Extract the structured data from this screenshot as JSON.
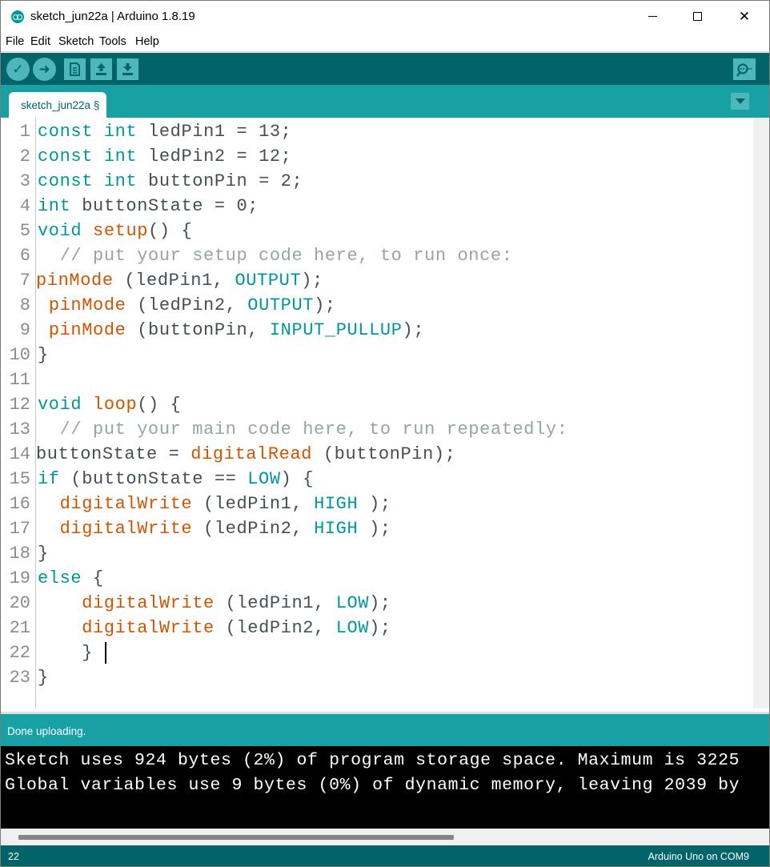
{
  "window": {
    "title": "sketch_jun22a | Arduino 1.8.19",
    "minimize_glyph": "",
    "close_glyph": "✕"
  },
  "menu": [
    "File",
    "Edit",
    "Sketch",
    "Tools",
    "Help"
  ],
  "toolbar": {
    "buttons": [
      "verify-icon",
      "upload-icon",
      "new-icon",
      "open-icon",
      "save-icon",
      "serial-monitor-icon"
    ],
    "verify_glyph": "✓",
    "upload_glyph": "➜"
  },
  "tab": {
    "label": "sketch_jun22a §"
  },
  "editor": {
    "lines": [
      {
        "num": "1",
        "tokens": [
          [
            "kw",
            "const"
          ],
          [
            "t",
            " "
          ],
          [
            "kw",
            "int"
          ],
          [
            "t",
            " ledPin1 = 13;"
          ]
        ]
      },
      {
        "num": "2",
        "tokens": [
          [
            "kw",
            "const"
          ],
          [
            "t",
            " "
          ],
          [
            "kw",
            "int"
          ],
          [
            "t",
            " ledPin2 = 12;"
          ]
        ]
      },
      {
        "num": "3",
        "tokens": [
          [
            "kw",
            "const"
          ],
          [
            "t",
            " "
          ],
          [
            "kw",
            "int"
          ],
          [
            "t",
            " buttonPin = 2;"
          ]
        ]
      },
      {
        "num": "4",
        "tokens": [
          [
            "kw",
            "int"
          ],
          [
            "t",
            " buttonState = 0;"
          ]
        ]
      },
      {
        "num": "5",
        "tokens": [
          [
            "kw",
            "void"
          ],
          [
            "t",
            " "
          ],
          [
            "fn",
            "setup"
          ],
          [
            "t",
            "() {"
          ]
        ]
      },
      {
        "num": "6",
        "tokens": [
          [
            "cm",
            "  // put your setup code here, to run once:"
          ]
        ]
      },
      {
        "num": "7",
        "tokens": [
          [
            "fn",
            "pinMode"
          ],
          [
            "t",
            " (ledPin1, "
          ],
          [
            "cst",
            "OUTPUT"
          ],
          [
            "t",
            ");"
          ]
        ]
      },
      {
        "num": "8",
        "tokens": [
          [
            "t",
            " "
          ],
          [
            "fn",
            "pinMode"
          ],
          [
            "t",
            " (ledPin2, "
          ],
          [
            "cst",
            "OUTPUT"
          ],
          [
            "t",
            ");"
          ]
        ]
      },
      {
        "num": "9",
        "tokens": [
          [
            "t",
            " "
          ],
          [
            "fn",
            "pinMode"
          ],
          [
            "t",
            " (buttonPin, "
          ],
          [
            "cst",
            "INPUT_PULLUP"
          ],
          [
            "t",
            ");"
          ]
        ]
      },
      {
        "num": "10",
        "tokens": [
          [
            "t",
            "}"
          ]
        ]
      },
      {
        "num": "11",
        "tokens": []
      },
      {
        "num": "12",
        "tokens": [
          [
            "kw",
            "void"
          ],
          [
            "t",
            " "
          ],
          [
            "fn",
            "loop"
          ],
          [
            "t",
            "() {"
          ]
        ]
      },
      {
        "num": "13",
        "tokens": [
          [
            "cm",
            "  // put your main code here, to run repeatedly:"
          ]
        ]
      },
      {
        "num": "14",
        "tokens": [
          [
            "t",
            "buttonState = "
          ],
          [
            "fn",
            "digitalRead"
          ],
          [
            "t",
            " (buttonPin);"
          ]
        ]
      },
      {
        "num": "15",
        "tokens": [
          [
            "kw",
            "if"
          ],
          [
            "t",
            " (buttonState == "
          ],
          [
            "cst",
            "LOW"
          ],
          [
            "t",
            ") {"
          ]
        ]
      },
      {
        "num": "16",
        "tokens": [
          [
            "t",
            "  "
          ],
          [
            "fn",
            "digitalWrite"
          ],
          [
            "t",
            " (ledPin1, "
          ],
          [
            "cst",
            "HIGH"
          ],
          [
            "t",
            " );"
          ]
        ]
      },
      {
        "num": "17",
        "tokens": [
          [
            "t",
            "  "
          ],
          [
            "fn",
            "digitalWrite"
          ],
          [
            "t",
            " (ledPin2, "
          ],
          [
            "cst",
            "HIGH"
          ],
          [
            "t",
            " );"
          ]
        ]
      },
      {
        "num": "18",
        "tokens": [
          [
            "t",
            "}"
          ]
        ]
      },
      {
        "num": "19",
        "tokens": [
          [
            "kw",
            "else"
          ],
          [
            "t",
            " {"
          ]
        ]
      },
      {
        "num": "20",
        "tokens": [
          [
            "t",
            "    "
          ],
          [
            "fn",
            "digitalWrite"
          ],
          [
            "t",
            " (ledPin1, "
          ],
          [
            "cst",
            "LOW"
          ],
          [
            "t",
            ");"
          ]
        ]
      },
      {
        "num": "21",
        "tokens": [
          [
            "t",
            "    "
          ],
          [
            "fn",
            "digitalWrite"
          ],
          [
            "t",
            " (ledPin2, "
          ],
          [
            "cst",
            "LOW"
          ],
          [
            "t",
            ");"
          ]
        ]
      },
      {
        "num": "22",
        "tokens": [
          [
            "t",
            "    } "
          ]
        ]
      },
      {
        "num": "23",
        "tokens": [
          [
            "t",
            "}"
          ]
        ]
      }
    ]
  },
  "status": {
    "message": "Done uploading."
  },
  "console": {
    "lines": [
      "Sketch uses 924 bytes (2%) of program storage space. Maximum is 3225",
      "Global variables use 9 bytes (0%) of dynamic memory, leaving 2039 by"
    ]
  },
  "footer": {
    "line_number": "22",
    "board_port": "Arduino Uno on COM9"
  },
  "colors": {
    "toolbar": "#006468",
    "tabstrip": "#17a1a5",
    "button": "#4db7bb",
    "keyword": "#00979c",
    "function": "#d35400",
    "comment": "#95a5a6"
  }
}
